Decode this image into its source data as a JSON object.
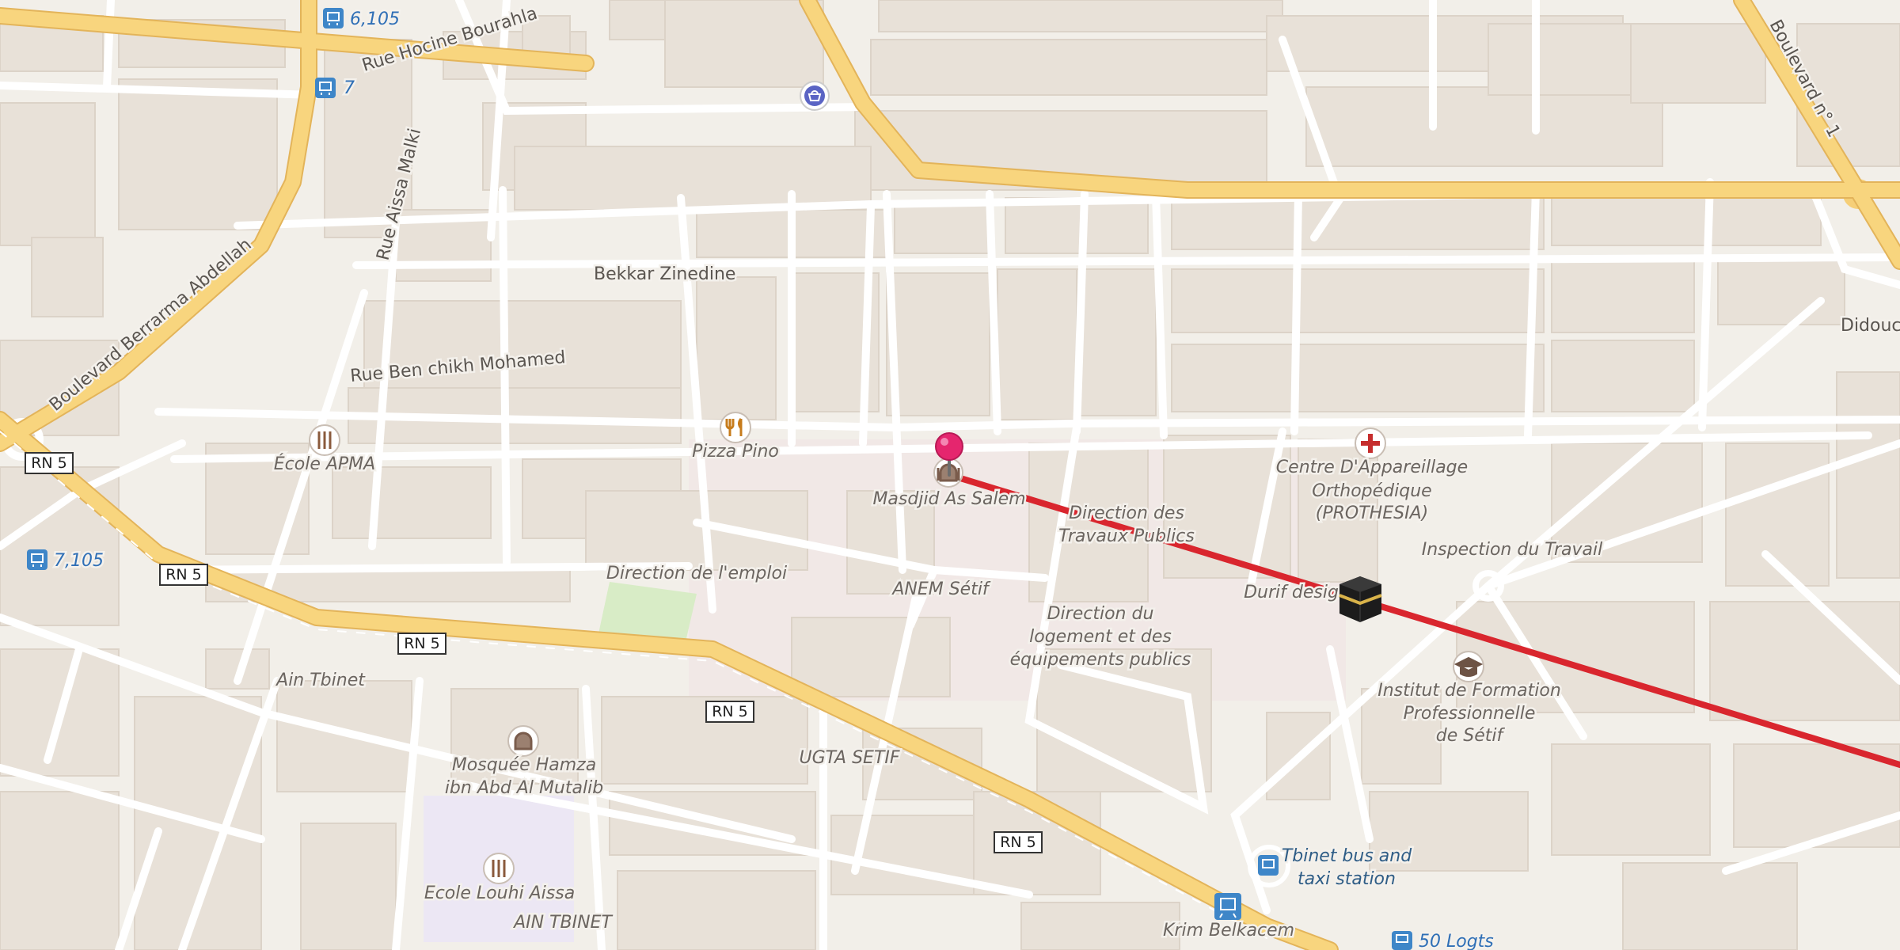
{
  "map": {
    "route_color": "#d9262e",
    "pin_color": "#e5266e",
    "destination_icon": "kaaba-icon",
    "streets": [
      "Rue Hocine Bourahla",
      "Rue Aissa Malki",
      "Boulevard Berrarma Abdellah",
      "Bekkar Zinedine",
      "Rue Ben chikh Mohamed",
      "Boulevard n° 1",
      "Didouche"
    ],
    "road_shields": [
      "RN 5",
      "RN 5",
      "RN 5",
      "RN 5",
      "RN 5"
    ],
    "bus_stops": [
      {
        "label": "6,105",
        "icon": "bus-stop-icon"
      },
      {
        "label": "7",
        "icon": "bus-stop-icon"
      },
      {
        "label": "7,105",
        "icon": "bus-stop-icon"
      },
      {
        "label": "50 Logts",
        "icon": "bus-stop-icon"
      }
    ],
    "pois": {
      "ecole_apma": "École APMA",
      "pizza_pino": "Pizza Pino",
      "masdjid": "Masdjid As Salem",
      "centre_line1": "Centre D'Appareillage",
      "centre_line2": "Orthopédique",
      "centre_line3": "(PROTHESIA)",
      "travaux_line1": "Direction des",
      "travaux_line2": "Travaux Publics",
      "inspection": "Inspection du Travail",
      "emploi": "Direction de l'emploi",
      "anem": "ANEM Sétif",
      "durif": "Durif design",
      "logement_line1": "Direction du",
      "logement_line2": "logement et des",
      "logement_line3": "équipements publics",
      "institut_line1": "Institut de Formation",
      "institut_line2": "Professionnelle",
      "institut_line3": "de Sétif",
      "ain_tbinet": "Ain Tbinet",
      "mosquee_line1": "Mosquée Hamza",
      "mosquee_line2": "ibn Abd Al Mutalib",
      "ugta": "UGTA SETIF",
      "ecole_louhi": "Ecole Louhi Aissa",
      "ain_tbinet_caps": "AIN TBINET",
      "tbinet_station_line1": "Tbinet bus and",
      "tbinet_station_line2": "taxi station",
      "krim": "Krim Belkacem"
    }
  }
}
